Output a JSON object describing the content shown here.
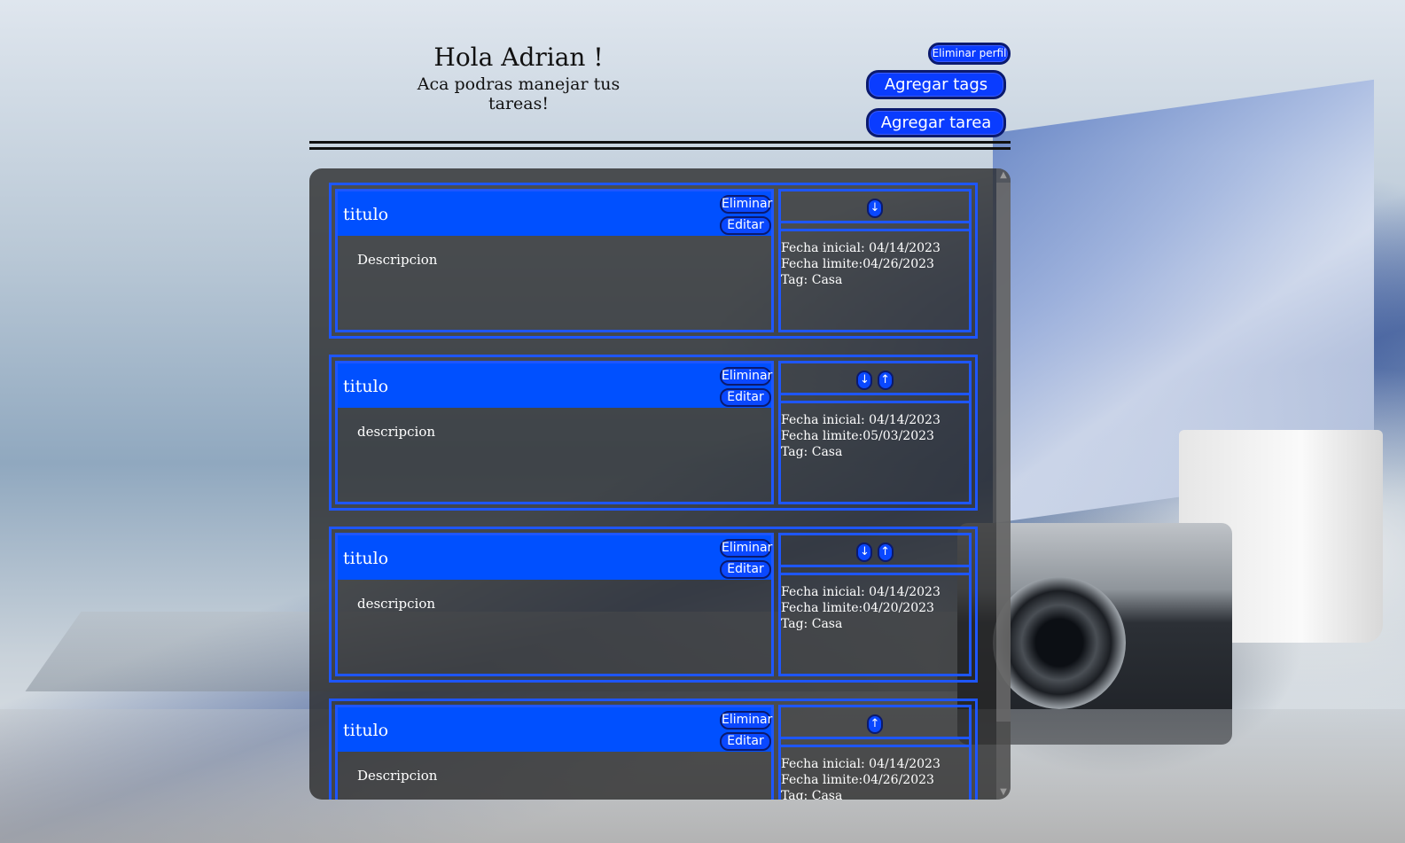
{
  "header": {
    "greeting": "Hola Adrian !",
    "subtitle": "Aca podras manejar tus tareas!",
    "delete_profile_label": "Eliminar perfil",
    "add_tags_label": "Agregar tags",
    "add_task_label": "Agregar tarea"
  },
  "task_labels": {
    "delete": "Eliminar",
    "edit": "Editar"
  },
  "tasks": [
    {
      "title": "titulo",
      "description": "Descripcion",
      "start": "Fecha inicial: 04/14/2023",
      "end": "Fecha limite:04/26/2023",
      "tag": "Tag: Casa",
      "arrows": [
        "↓"
      ]
    },
    {
      "title": "titulo",
      "description": "descripcion",
      "start": "Fecha inicial: 04/14/2023",
      "end": "Fecha limite:05/03/2023",
      "tag": "Tag: Casa",
      "arrows": [
        "↓",
        "↑"
      ]
    },
    {
      "title": "titulo",
      "description": "descripcion",
      "start": "Fecha inicial: 04/14/2023",
      "end": "Fecha limite:04/20/2023",
      "tag": "Tag: Casa",
      "arrows": [
        "↓",
        "↑"
      ]
    },
    {
      "title": "titulo",
      "description": "Descripcion",
      "start": "Fecha inicial: 04/14/2023",
      "end": "Fecha limite:04/26/2023",
      "tag": "Tag: Casa",
      "arrows": [
        "↑"
      ]
    }
  ],
  "colors": {
    "accent": "#0050ff",
    "border": "#1e56ff",
    "button_border": "#0b1a6e"
  }
}
